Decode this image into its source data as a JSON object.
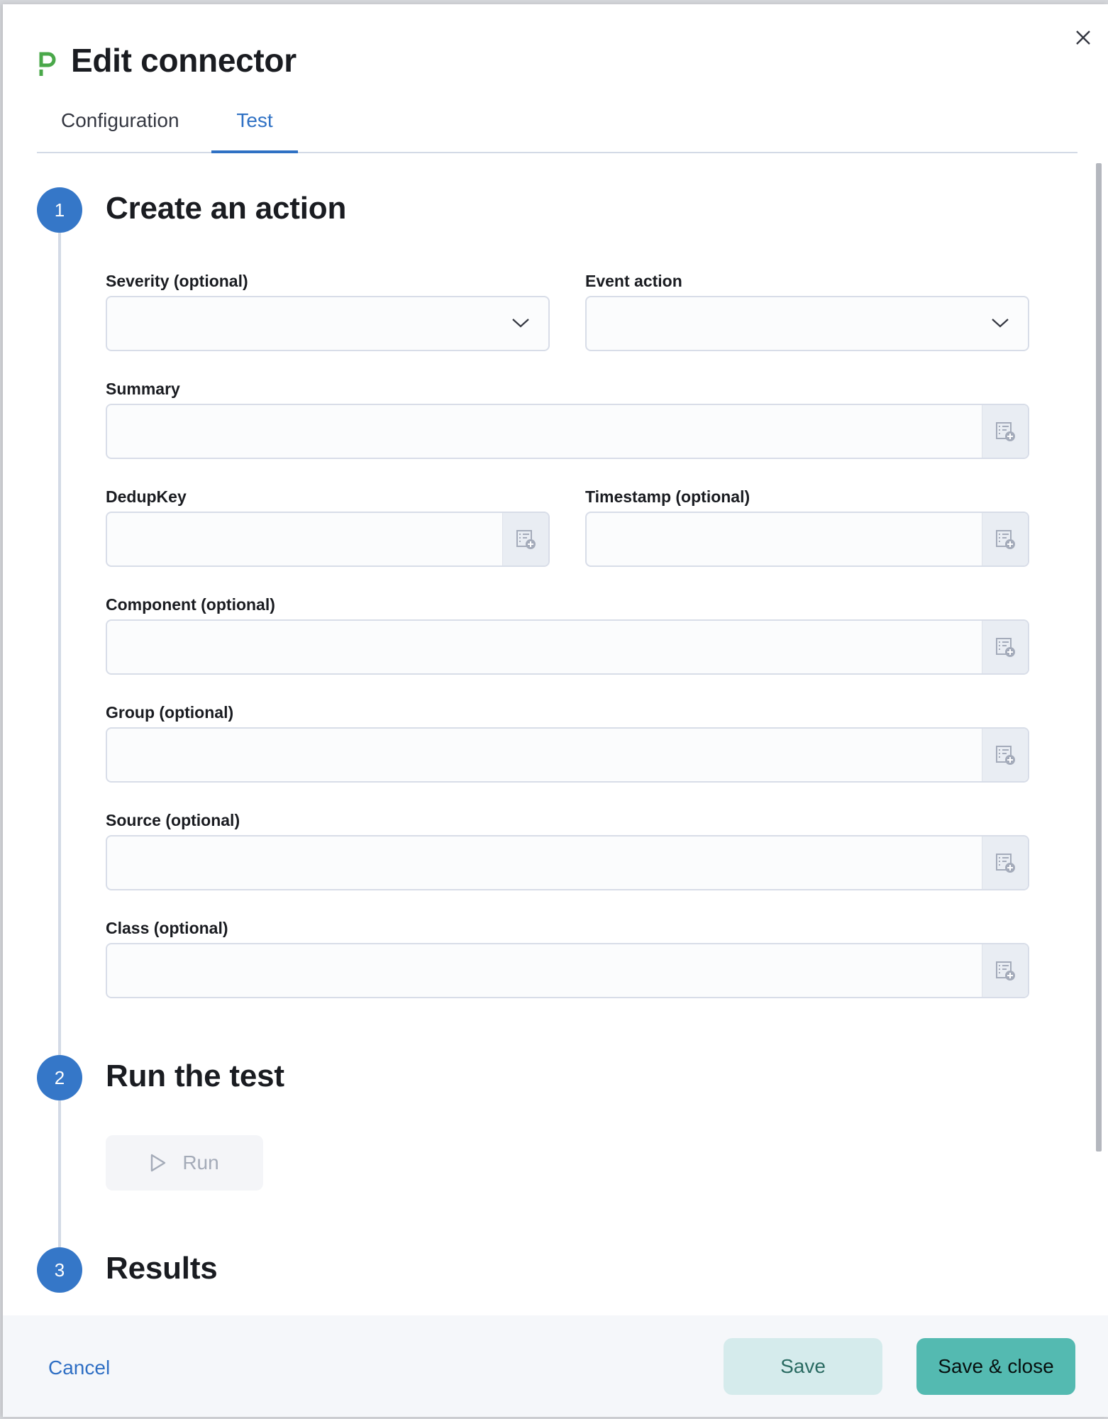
{
  "header": {
    "title": "Edit connector",
    "logo_icon": "pagerduty-logo",
    "close_icon": "close-icon"
  },
  "tabs": [
    {
      "label": "Configuration",
      "active": false
    },
    {
      "label": "Test",
      "active": true
    }
  ],
  "steps": [
    {
      "number": "1",
      "title": "Create an action"
    },
    {
      "number": "2",
      "title": "Run the test"
    },
    {
      "number": "3",
      "title": "Results"
    }
  ],
  "form": {
    "severity": {
      "label": "Severity (optional)",
      "value": ""
    },
    "event_action": {
      "label": "Event action",
      "value": ""
    },
    "summary": {
      "label": "Summary",
      "value": ""
    },
    "dedup_key": {
      "label": "DedupKey",
      "value": ""
    },
    "timestamp": {
      "label": "Timestamp (optional)",
      "value": ""
    },
    "component": {
      "label": "Component (optional)",
      "value": ""
    },
    "group": {
      "label": "Group (optional)",
      "value": ""
    },
    "source": {
      "label": "Source (optional)",
      "value": ""
    },
    "class": {
      "label": "Class (optional)",
      "value": ""
    }
  },
  "run": {
    "label": "Run",
    "disabled": true
  },
  "footer": {
    "cancel": "Cancel",
    "save": "Save",
    "save_close": "Save & close"
  },
  "colors": {
    "accent": "#3577c8",
    "brand": "#54bab1",
    "logo": "#4aa84a"
  }
}
